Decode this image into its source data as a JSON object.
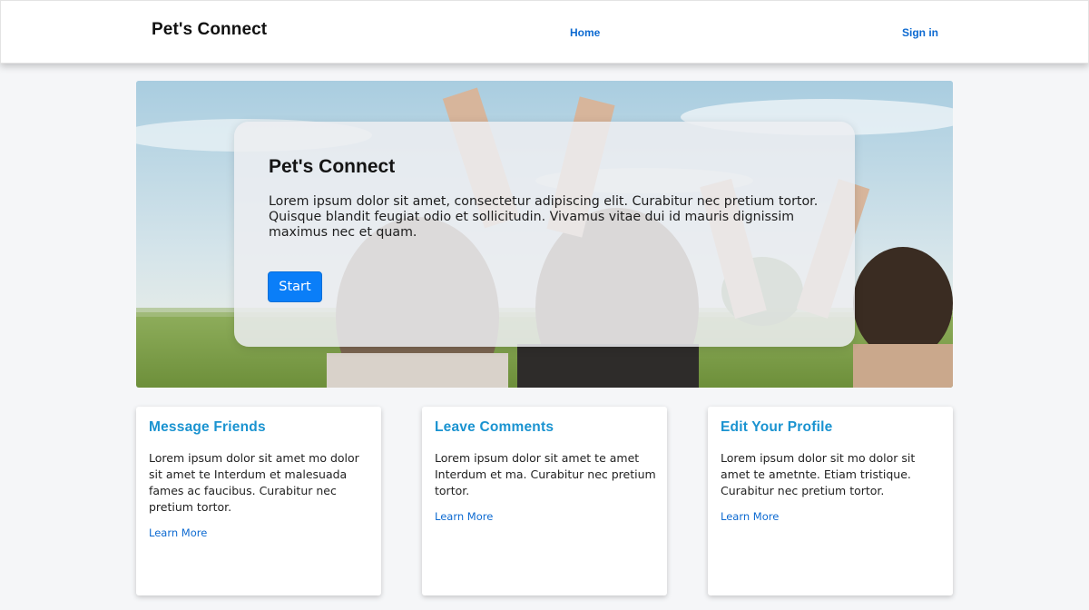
{
  "header": {
    "brand": "Pet's Connect",
    "nav": {
      "home": "Home",
      "sign_in": "Sign in"
    }
  },
  "hero": {
    "title": "Pet's Connect",
    "text": "Lorem ipsum dolor sit amet, consectetur adipiscing elit. Curabitur nec pretium tortor. Quisque blandit feugiat odio et sollicitudin. Vivamus vitae dui id mauris dignissim maximus nec et quam.",
    "button": "Start"
  },
  "cards": [
    {
      "title": "Message Friends",
      "text": "Lorem ipsum dolor sit amet mo dolor sit amet te Interdum et malesuada fames ac faucibus. Curabitur nec pretium tortor.",
      "link": "Learn More"
    },
    {
      "title": "Leave Comments",
      "text": "Lorem ipsum dolor sit amet te amet Interdum et ma. Curabitur nec pretium tortor.",
      "link": "Learn More"
    },
    {
      "title": "Edit Your Profile",
      "text": "Lorem ipsum dolor sit mo dolor sit amet te ametnte. Etiam tristique. Curabitur nec pretium tortor.",
      "link": "Learn More"
    }
  ],
  "colors": {
    "accent": "#0a7ef8",
    "link": "#0d6ad1",
    "card_title": "#1a93d0"
  }
}
